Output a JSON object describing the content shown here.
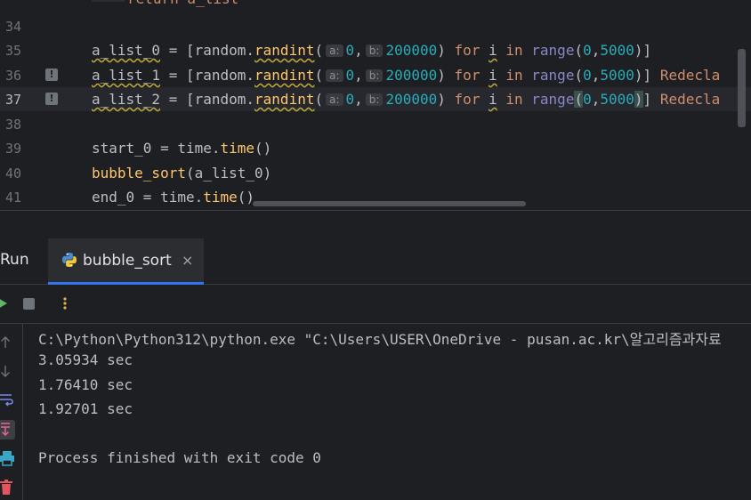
{
  "editor": {
    "line_numbers": [
      "34",
      "35",
      "36",
      "37",
      "38",
      "39",
      "40",
      "41"
    ],
    "top_line_text": "return a_list",
    "lines": [
      {
        "var": "a_list_0",
        "assign": " = [",
        "mod": "random.",
        "fn": "randint",
        "open": "(",
        "hint_a": "a:",
        "val_a": "0",
        "comma": ",",
        "hint_b": "b:",
        "val_b": "200000",
        "close": ")",
        "for": "for",
        "i": "i",
        "in": "in",
        "range": "range",
        "rargs_open": "(",
        "r0": "0",
        "rc": ",",
        "r1": "5000",
        "rargs_close": ")",
        "tail": "]",
        "warn": ""
      },
      {
        "var": "a_list_1",
        "assign": " = [",
        "mod": "random.",
        "fn": "randint",
        "open": "(",
        "hint_a": "a:",
        "val_a": "0",
        "comma": ",",
        "hint_b": "b:",
        "val_b": "200000",
        "close": ")",
        "for": "for",
        "i": "i",
        "in": "in",
        "range": "range",
        "rargs_open": "(",
        "r0": "0",
        "rc": ",",
        "r1": "5000",
        "rargs_close": ")",
        "tail": "]",
        "warn": "Redecla"
      },
      {
        "var": "a_list_2",
        "assign": " = [",
        "mod": "random.",
        "fn": "randint",
        "open": "(",
        "hint_a": "a:",
        "val_a": "0",
        "comma": ",",
        "hint_b": "b:",
        "val_b": "200000",
        "close": ")",
        "for": "for",
        "i": "i",
        "in": "in",
        "range": "range",
        "rargs_open": "(",
        "r0": "0",
        "rc": ",",
        "r1": "5000",
        "rargs_close": ")",
        "tail": "]",
        "warn": "Redecla"
      }
    ],
    "start_line": {
      "lhs": "start_0 = time.",
      "fn": "time",
      "args": "()"
    },
    "sort_line": {
      "fn": "bubble_sort",
      "args": "(a_list_0)"
    },
    "end_line": {
      "lhs": "end_0 = time.",
      "fn": "time",
      "args": "()"
    },
    "warning_marker": "!"
  },
  "run_panel": {
    "title": "Run",
    "tab_label": "bubble_sort",
    "tab_close": "×",
    "console_lines": [
      "C:\\Python\\Python312\\python.exe \"C:\\Users\\USER\\OneDrive - pusan.ac.kr\\알고리즘과자료",
      "3.05934 sec",
      "1.76410 sec",
      "1.92701 sec",
      "",
      "Process finished with exit code 0"
    ]
  },
  "colors": {
    "background": "#1e1f22",
    "accent": "#3574f0",
    "run_green": "#5fb865",
    "warning": "#cf8e6d"
  },
  "icons": [
    "breakpoint-icon",
    "warning-icon",
    "python-icon",
    "close-icon",
    "rerun-icon",
    "stop-icon",
    "more-options-icon",
    "scroll-up-icon",
    "scroll-down-icon",
    "soft-wrap-icon",
    "scroll-to-end-icon",
    "print-icon",
    "trash-icon"
  ]
}
